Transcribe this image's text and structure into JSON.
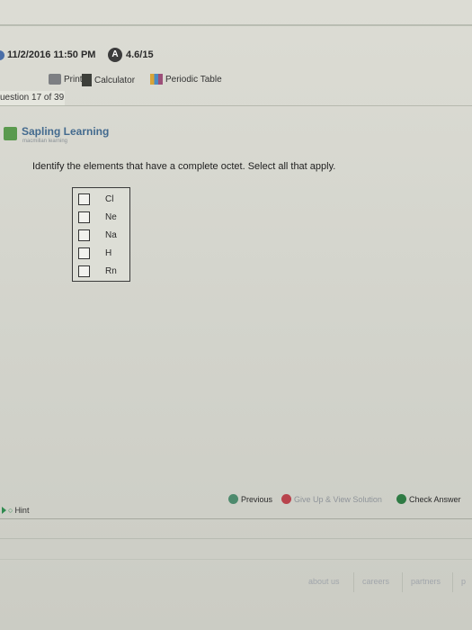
{
  "header": {
    "datetime": "11/2/2016 11:50 PM",
    "score_icon": "A",
    "score": "4.6/15"
  },
  "toolbar": {
    "print": "Print",
    "calculator": "Calculator",
    "periodic_table": "Periodic Table"
  },
  "question_nav": {
    "label": "uestion 17 of 39"
  },
  "brand": {
    "name": "Sapling Learning",
    "tagline": "macmillan learning"
  },
  "question": {
    "prompt": "Identify the elements that have a complete octet. Select all that apply.",
    "choices": [
      {
        "label": "Cl"
      },
      {
        "label": "Ne"
      },
      {
        "label": "Na"
      },
      {
        "label": "H"
      },
      {
        "label": "Rn"
      }
    ]
  },
  "actions": {
    "previous": "Previous",
    "give_up": "Give Up & View Solution",
    "check": "Check Answer",
    "hint": "Hint"
  },
  "footer": {
    "about": "about us",
    "careers": "careers",
    "partners": "partners",
    "more": "p"
  },
  "icons": {
    "print": "printer-icon",
    "calculator": "calculator-icon",
    "periodic_table": "periodic-table-icon",
    "previous": "previous-icon",
    "give_up": "give-up-icon",
    "check": "check-icon",
    "hint": "hint-icon"
  }
}
